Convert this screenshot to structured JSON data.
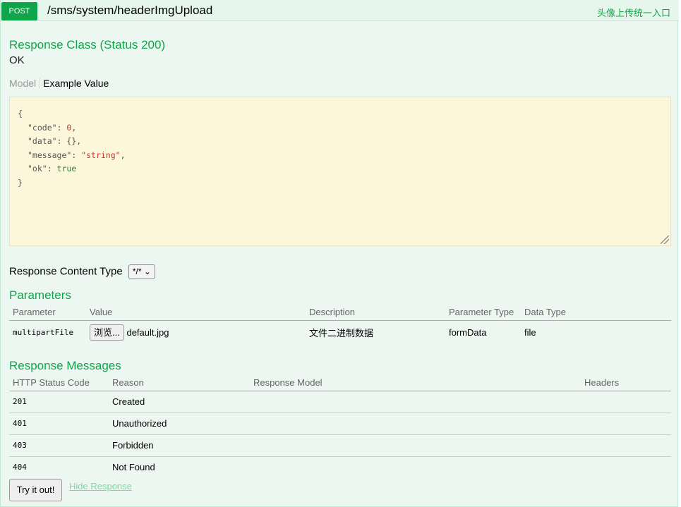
{
  "endpoint": {
    "method": "POST",
    "path": "/sms/system/headerImgUpload",
    "summary": "头像上传统一入口"
  },
  "response_class": {
    "title": "Response Class (Status 200)",
    "status_text": "OK",
    "tabs": {
      "model": "Model",
      "example": "Example Value"
    },
    "example_lines": {
      "open": "{",
      "code_key": "\"code\"",
      "code_val": "0",
      "data_key": "\"data\"",
      "data_val": "{}",
      "message_key": "\"message\"",
      "message_val": "\"string\"",
      "ok_key": "\"ok\"",
      "ok_val": "true",
      "close": "}"
    }
  },
  "response_content_type": {
    "label": "Response Content Type",
    "selected": "*/*"
  },
  "parameters": {
    "title": "Parameters",
    "columns": [
      "Parameter",
      "Value",
      "Description",
      "Parameter Type",
      "Data Type"
    ],
    "rows": [
      {
        "name": "multipartFile",
        "browse_label": "浏览...",
        "file_name": "default.jpg",
        "description": "文件二进制数据",
        "param_type": "formData",
        "data_type": "file"
      }
    ]
  },
  "response_messages": {
    "title": "Response Messages",
    "columns": [
      "HTTP Status Code",
      "Reason",
      "Response Model",
      "Headers"
    ],
    "rows": [
      {
        "code": "201",
        "reason": "Created"
      },
      {
        "code": "401",
        "reason": "Unauthorized"
      },
      {
        "code": "403",
        "reason": "Forbidden"
      },
      {
        "code": "404",
        "reason": "Not Found"
      }
    ]
  },
  "actions": {
    "try_it_out": "Try it out!",
    "hide_response": "Hide Response"
  },
  "colors": {
    "accent": "#10a54a",
    "panel_bg": "#ebf7f0",
    "code_bg": "#fcf6db"
  }
}
